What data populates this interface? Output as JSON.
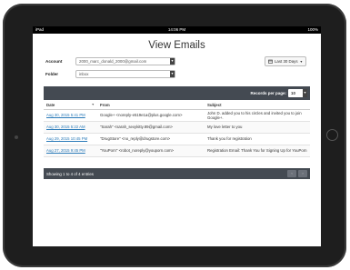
{
  "status_bar": {
    "left": "iPad",
    "time": "14:06 PM",
    "right": "100%"
  },
  "page_title": "View Emails",
  "filters": {
    "account_label": "Account",
    "account_value": "2000_marc_donald_2000@gmail.com",
    "folder_label": "Folder",
    "folder_value": "inbox",
    "date_range": "Last 30 Days"
  },
  "records_per_page": {
    "label": "Records per page:",
    "value": "10"
  },
  "table": {
    "columns": [
      "Date",
      "From",
      "Subject"
    ],
    "rows": [
      {
        "date": "Aug 30, 2015 5:41 PM",
        "from": "Google+ <noreply-e519e1a@plus.google.com>",
        "subject": "John D. added you to his circles and invited you to join Google+."
      },
      {
        "date": "Aug 30, 2015 5:22 AM",
        "from": "\"Sarah\" <sarah_sexykitty.89@gmail.com>",
        "subject": "My love letter to you"
      },
      {
        "date": "Aug 29, 2015 10:45 PM",
        "from": "\"DrugStore\" <no_reply@drugstore.com>",
        "subject": "Thank you for registration"
      },
      {
        "date": "Aug 27, 2015 9:45 PM",
        "from": "\"YouPorn\" <robot_noreply@youporn.com>",
        "subject": "Registration Email: Thank You for Signing Up for YouPorn"
      }
    ]
  },
  "footer": {
    "info": "Showing 1 to 4 of 4 entries",
    "prev": "‹",
    "next": "›"
  }
}
